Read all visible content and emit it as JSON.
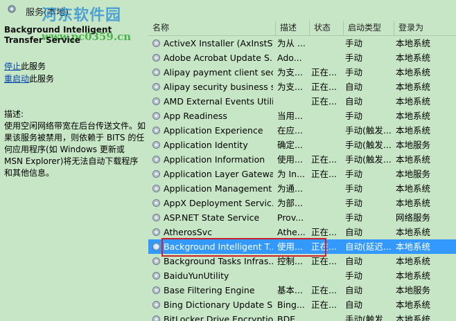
{
  "window": {
    "title": "服务(本地)"
  },
  "watermark": {
    "text": "河东软件园",
    "url": "www.pc0359.cn"
  },
  "left_pane": {
    "service_name": "Background Intelligent Transfer Service",
    "stop_link": "停止",
    "stop_suffix": "此服务",
    "restart_link": "重启动",
    "restart_suffix": "此服务",
    "desc_label": "描述:",
    "description": "使用空闲网络带宽在后台传送文件。如果该服务被禁用，则依赖于 BITS 的任何应用程序(如 Windows 更新或 MSN Explorer)将无法自动下载程序和其他信息。"
  },
  "columns": {
    "name": "名称",
    "desc": "描述",
    "status": "状态",
    "startup": "启动类型",
    "logon": "登录为"
  },
  "services": [
    {
      "name": "ActiveX Installer (AxInstSV)",
      "desc": "为从 ...",
      "status": "",
      "startup": "手动",
      "logon": "本地系统"
    },
    {
      "name": "Adobe Acrobat Update S...",
      "desc": "Ado...",
      "status": "",
      "startup": "手动",
      "logon": "本地系统"
    },
    {
      "name": "Alipay payment client sec...",
      "desc": "为支...",
      "status": "正在...",
      "startup": "手动",
      "logon": "本地系统"
    },
    {
      "name": "Alipay security business s...",
      "desc": "为支...",
      "status": "正在...",
      "startup": "自动",
      "logon": "本地系统"
    },
    {
      "name": "AMD External Events Utility",
      "desc": "",
      "status": "正在...",
      "startup": "自动",
      "logon": "本地系统"
    },
    {
      "name": "App Readiness",
      "desc": "当用...",
      "status": "",
      "startup": "手动",
      "logon": "本地系统"
    },
    {
      "name": "Application Experience",
      "desc": "在应...",
      "status": "",
      "startup": "手动(触发...",
      "logon": "本地系统"
    },
    {
      "name": "Application Identity",
      "desc": "确定...",
      "status": "",
      "startup": "手动(触发...",
      "logon": "本地服务"
    },
    {
      "name": "Application Information",
      "desc": "使用...",
      "status": "正在...",
      "startup": "手动(触发...",
      "logon": "本地系统"
    },
    {
      "name": "Application Layer Gatewa...",
      "desc": "为 In...",
      "status": "正在...",
      "startup": "手动",
      "logon": "本地服务"
    },
    {
      "name": "Application Management",
      "desc": "为通...",
      "status": "",
      "startup": "手动",
      "logon": "本地系统"
    },
    {
      "name": "AppX Deployment Servic...",
      "desc": "为部...",
      "status": "",
      "startup": "手动",
      "logon": "本地系统"
    },
    {
      "name": "ASP.NET State Service",
      "desc": "Prov...",
      "status": "",
      "startup": "手动",
      "logon": "网络服务"
    },
    {
      "name": "AtherosSvc",
      "desc": "Athe...",
      "status": "正在...",
      "startup": "自动",
      "logon": "本地系统"
    },
    {
      "name": "Background Intelligent T...",
      "desc": "使用...",
      "status": "正在...",
      "startup": "自动(延迟...",
      "logon": "本地系统",
      "selected": true
    },
    {
      "name": "Background Tasks Infras...",
      "desc": "控制...",
      "status": "正在...",
      "startup": "自动",
      "logon": "本地系统"
    },
    {
      "name": "BaiduYunUtility",
      "desc": "",
      "status": "",
      "startup": "手动",
      "logon": "本地系统"
    },
    {
      "name": "Base Filtering Engine",
      "desc": "基本...",
      "status": "正在...",
      "startup": "自动",
      "logon": "本地服务"
    },
    {
      "name": "Bing Dictionary Update S...",
      "desc": "Bing...",
      "status": "正在...",
      "startup": "自动",
      "logon": "本地系统"
    },
    {
      "name": "BitLocker Drive Encryptio...",
      "desc": "BDE...",
      "status": "",
      "startup": "手动(触发...",
      "logon": "本地系统"
    }
  ],
  "colors": {
    "background": "#c7e6c6",
    "selection": "#3399ff",
    "link": "#0645ad",
    "highlight_box": "#d0202a"
  }
}
